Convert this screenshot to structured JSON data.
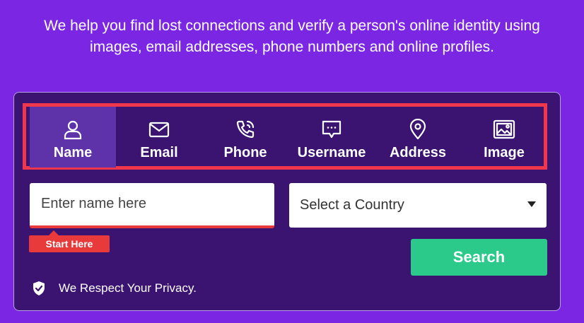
{
  "tagline": {
    "line1": "We help you find lost connections and verify a person's online identity using",
    "line2": "images, email addresses, phone numbers and online profiles."
  },
  "tabs": [
    {
      "label": "Name",
      "icon": "person-icon",
      "active": true
    },
    {
      "label": "Email",
      "icon": "envelope-icon",
      "active": false
    },
    {
      "label": "Phone",
      "icon": "phone-icon",
      "active": false
    },
    {
      "label": "Username",
      "icon": "chat-bubble-icon",
      "active": false
    },
    {
      "label": "Address",
      "icon": "map-pin-icon",
      "active": false
    },
    {
      "label": "Image",
      "icon": "image-icon",
      "active": false
    }
  ],
  "name_input": {
    "placeholder": "Enter name here",
    "value": ""
  },
  "start_here_label": "Start Here",
  "country_select": {
    "selected": "Select a Country"
  },
  "search_label": "Search",
  "privacy_text": "We Respect Your Privacy.",
  "colors": {
    "background": "#7b26e3",
    "card": "#3a1470",
    "active_tab": "#5e32a8",
    "highlight_red": "#f0374b",
    "search_green": "#2bc98a"
  }
}
